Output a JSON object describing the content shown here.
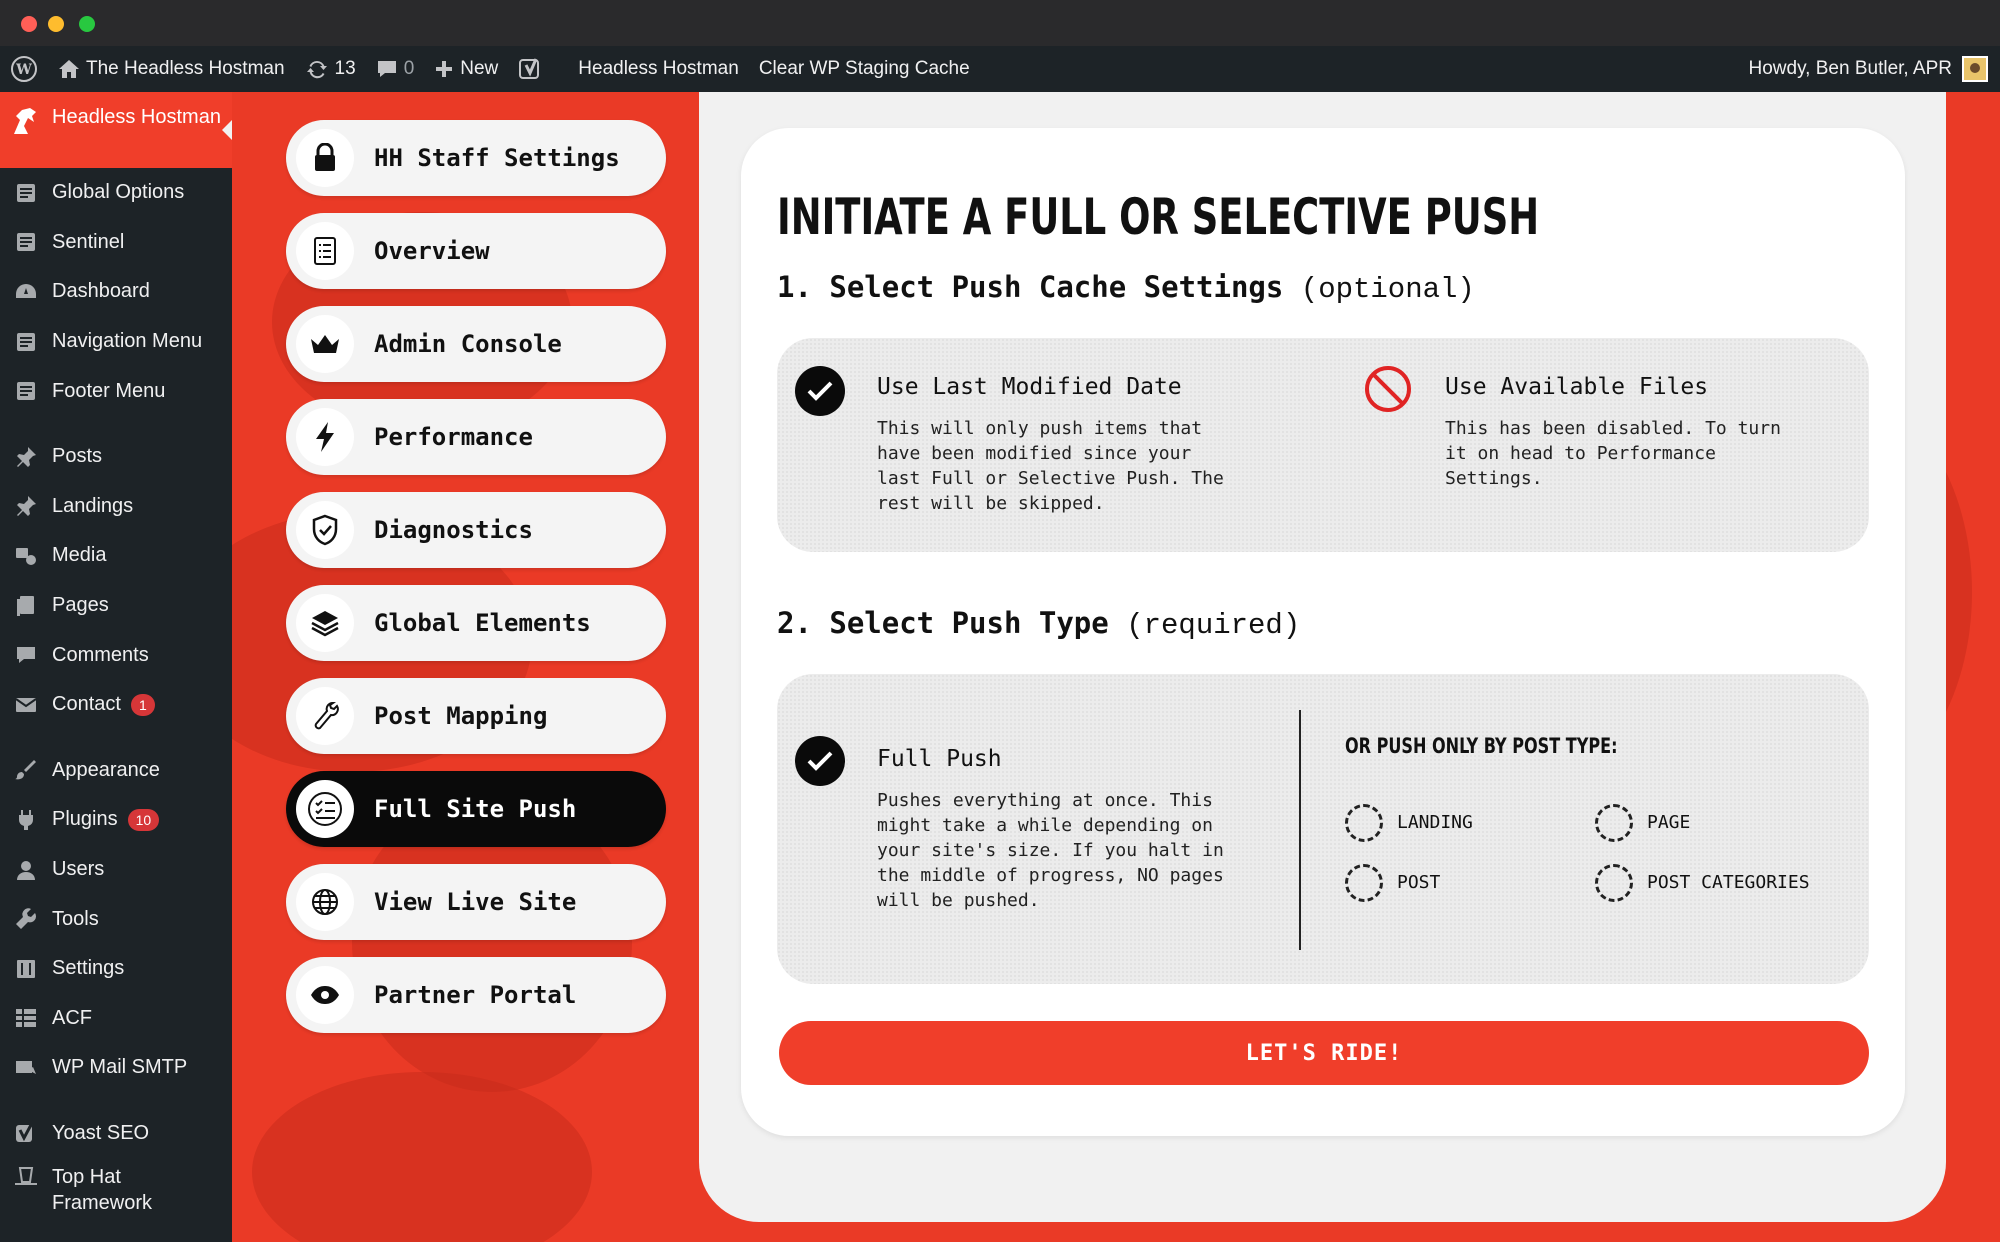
{
  "adminbar": {
    "site_name": "The Headless Hostman",
    "updates_count": "13",
    "comments_count": "0",
    "new_label": "New",
    "link_1": "Headless Hostman",
    "link_2": "Clear WP Staging Cache",
    "greeting": "Howdy, Ben Butler, APR"
  },
  "sidebar": {
    "active": "Headless Hostman",
    "items": [
      {
        "label": "Global Options",
        "icon": "document-icon"
      },
      {
        "label": "Sentinel",
        "icon": "document-icon"
      },
      {
        "label": "Dashboard",
        "icon": "dashboard-icon"
      },
      {
        "label": "Navigation Menu",
        "icon": "document-icon"
      },
      {
        "label": "Footer Menu",
        "icon": "document-icon"
      },
      {
        "label": "Posts",
        "icon": "pin-icon"
      },
      {
        "label": "Landings",
        "icon": "pin-icon"
      },
      {
        "label": "Media",
        "icon": "media-icon"
      },
      {
        "label": "Pages",
        "icon": "pages-icon"
      },
      {
        "label": "Comments",
        "icon": "comment-icon"
      },
      {
        "label": "Contact",
        "icon": "mail-icon",
        "badge": "1"
      },
      {
        "label": "Appearance",
        "icon": "brush-icon"
      },
      {
        "label": "Plugins",
        "icon": "plug-icon",
        "badge": "10"
      },
      {
        "label": "Users",
        "icon": "user-icon"
      },
      {
        "label": "Tools",
        "icon": "wrench-icon"
      },
      {
        "label": "Settings",
        "icon": "sliders-icon"
      },
      {
        "label": "ACF",
        "icon": "table-icon"
      },
      {
        "label": "WP Mail SMTP",
        "icon": "mail-send-icon"
      },
      {
        "label": "Yoast SEO",
        "icon": "yoast-icon"
      },
      {
        "label": "Top Hat Framework",
        "icon": "tophat-icon"
      }
    ]
  },
  "menu": {
    "items": [
      {
        "label": "HH Staff Settings",
        "icon": "lock-icon"
      },
      {
        "label": "Overview",
        "icon": "list-icon"
      },
      {
        "label": "Admin Console",
        "icon": "crown-icon"
      },
      {
        "label": "Performance",
        "icon": "bolt-icon"
      },
      {
        "label": "Diagnostics",
        "icon": "shield-check-icon"
      },
      {
        "label": "Global Elements",
        "icon": "layers-icon"
      },
      {
        "label": "Post Mapping",
        "icon": "wrench-icon"
      },
      {
        "label": "Full Site Push",
        "icon": "checklist-icon",
        "active": true
      },
      {
        "label": "View Live Site",
        "icon": "globe-icon"
      },
      {
        "label": "Partner Portal",
        "icon": "eye-icon"
      }
    ]
  },
  "main": {
    "title": "INITIATE A FULL OR SELECTIVE PUSH",
    "step1": {
      "title": "1. Select Push Cache Settings",
      "note": "(optional)"
    },
    "cache_opts": [
      {
        "title": "Use Last Modified Date",
        "desc": "This will only push items that\nhave been modified since your\nlast Full or Selective Push. The\nrest will be skipped.",
        "state": "checked"
      },
      {
        "title": "Use Available Files",
        "desc": "This has been disabled. To turn\nit on head to Performance\nSettings.",
        "state": "disabled"
      }
    ],
    "step2": {
      "title": "2. Select Push Type",
      "note": "(required)"
    },
    "full_push": {
      "title": "Full Push",
      "desc": "Pushes everything at once. This\nmight take a while depending on\nyour site's size. If you halt in\nthe middle of progress, NO pages\nwill be pushed."
    },
    "by_type_heading": "OR PUSH ONLY BY POST TYPE:",
    "post_types": [
      "LANDING",
      "PAGE",
      "POST",
      "POST CATEGORIES"
    ],
    "submit_label": "LET'S RIDE!"
  }
}
